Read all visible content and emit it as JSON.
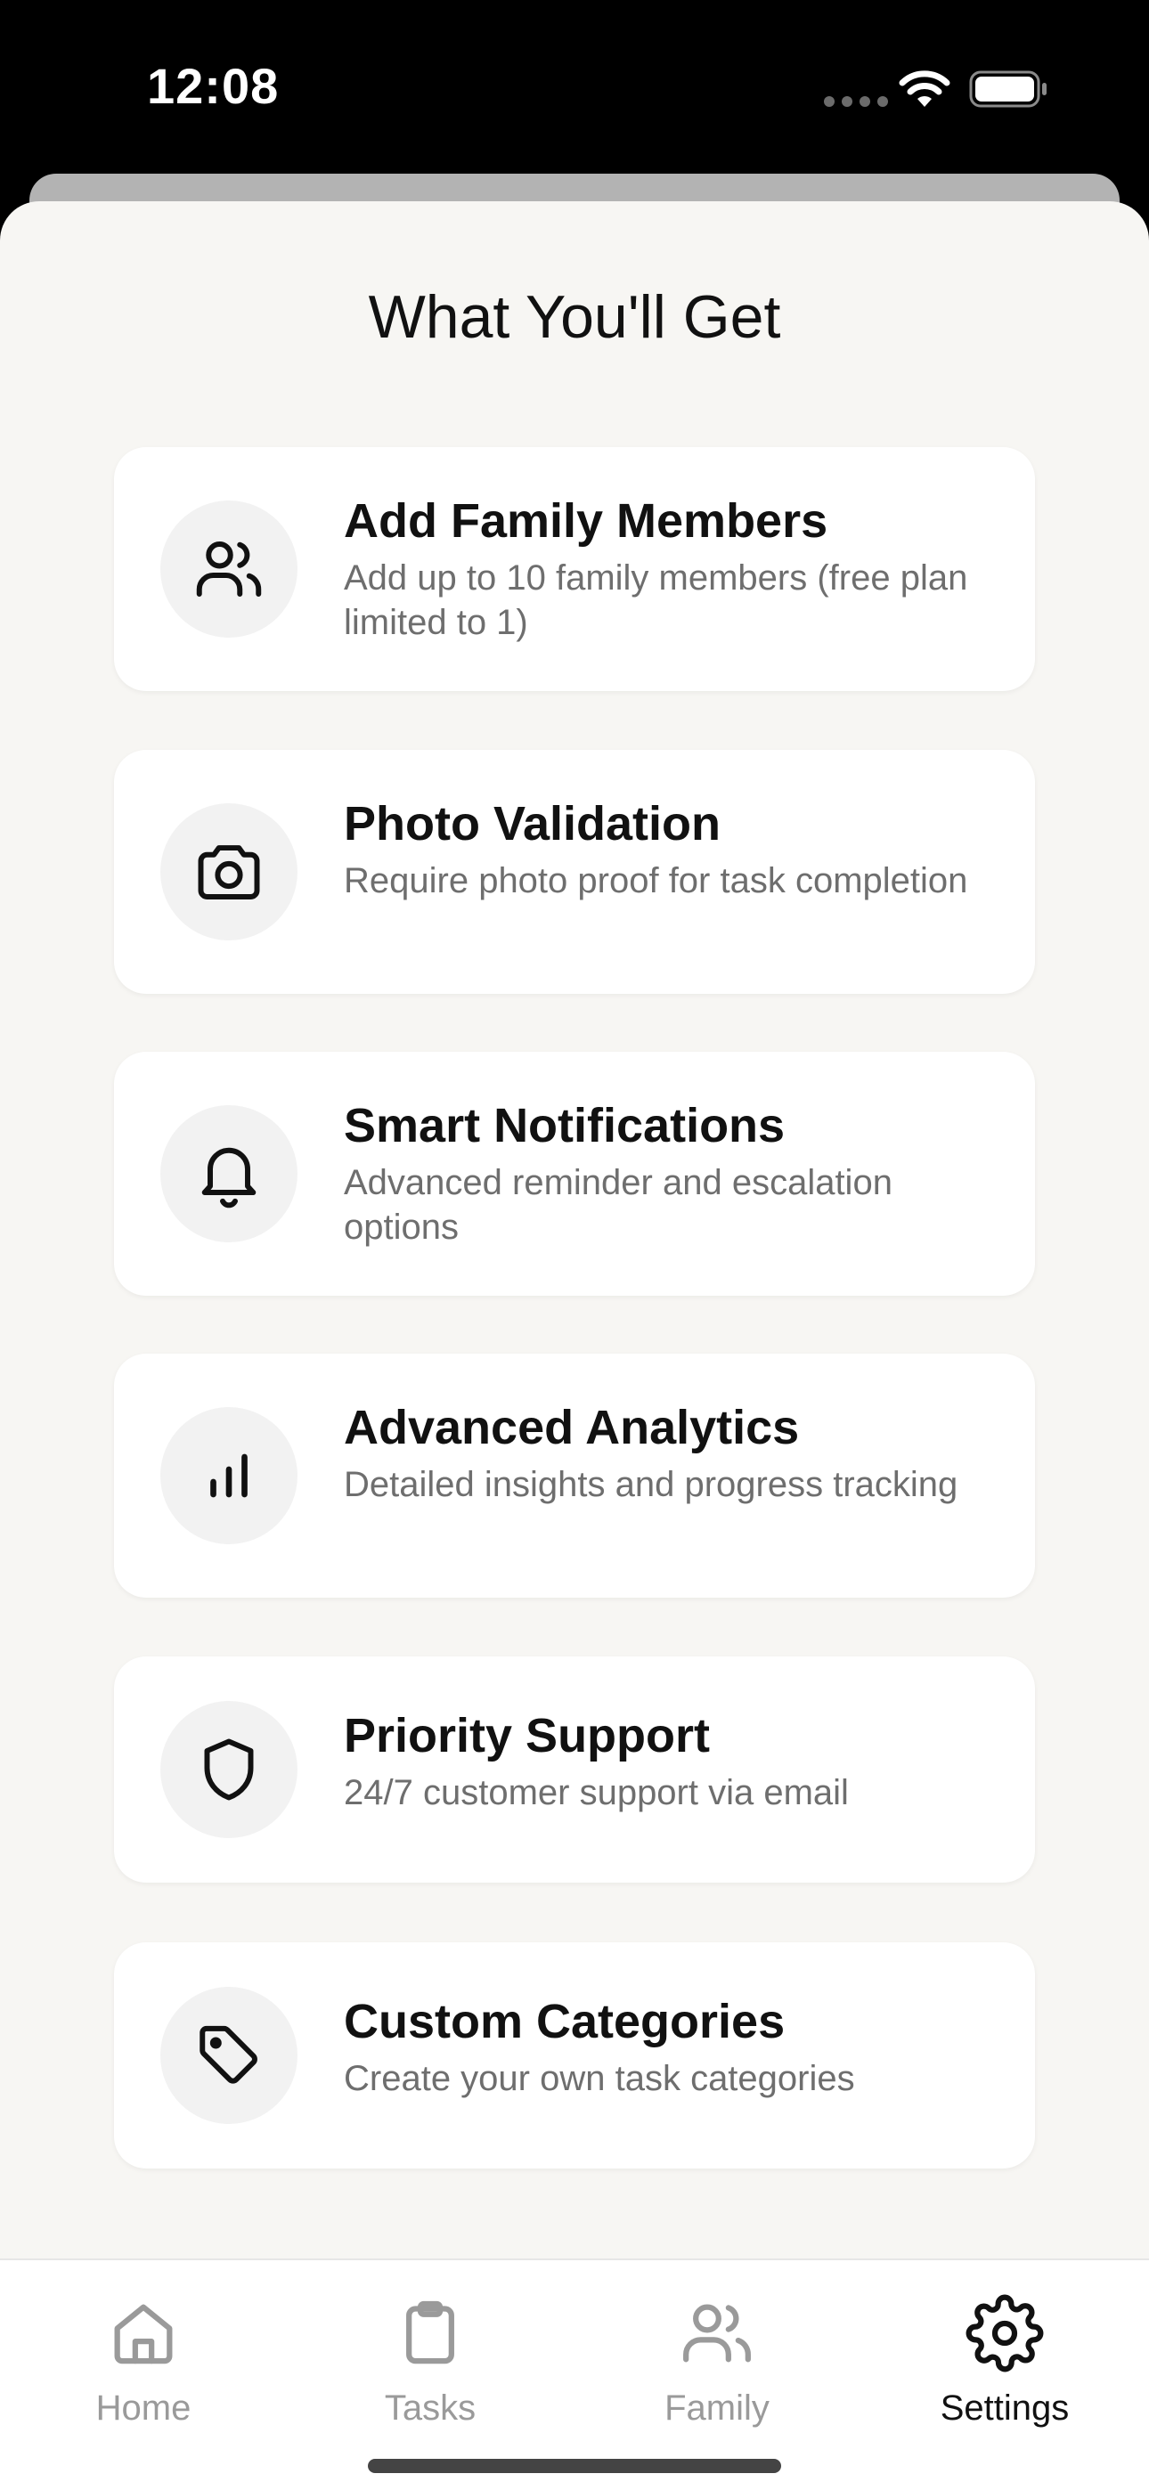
{
  "status_bar": {
    "time": "12:08"
  },
  "sheet": {
    "title": "What You'll Get",
    "features": [
      {
        "icon": "users-icon",
        "title": "Add Family Members",
        "description": "Add up to 10 family members (free plan limited to 1)"
      },
      {
        "icon": "camera-icon",
        "title": "Photo Validation",
        "description": "Require photo proof for task completion"
      },
      {
        "icon": "bell-icon",
        "title": "Smart Notifications",
        "description": "Advanced reminder and escalation options"
      },
      {
        "icon": "bar-chart-icon",
        "title": "Advanced Analytics",
        "description": "Detailed insights and progress tracking"
      },
      {
        "icon": "shield-icon",
        "title": "Priority Support",
        "description": "24/7 customer support via email"
      },
      {
        "icon": "tag-icon",
        "title": "Custom Categories",
        "description": "Create your own task categories"
      }
    ]
  },
  "tab_bar": {
    "tabs": [
      {
        "label": "Home",
        "icon": "home-icon",
        "active": false
      },
      {
        "label": "Tasks",
        "icon": "clipboard-icon",
        "active": false
      },
      {
        "label": "Family",
        "icon": "users-icon",
        "active": false
      },
      {
        "label": "Settings",
        "icon": "gear-icon",
        "active": true
      }
    ]
  },
  "colors": {
    "sheet_bg": "#f7f6f3",
    "card_bg": "#ffffff",
    "text_primary": "#111111",
    "text_secondary": "#6e6e6e",
    "tab_inactive": "#9a9a9a"
  }
}
